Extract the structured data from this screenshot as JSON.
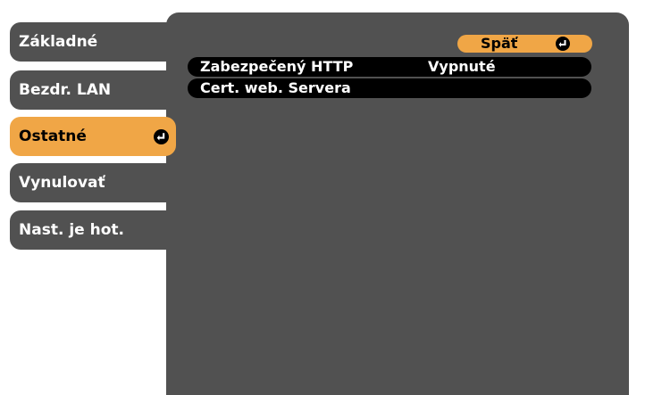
{
  "menu": {
    "tabs": [
      {
        "label": "Základné"
      },
      {
        "label": "Bezdr. LAN"
      },
      {
        "label": "Ostatné"
      },
      {
        "label": "Vynulovať"
      },
      {
        "label": "Nast. je hot."
      }
    ],
    "selected_index": 2
  },
  "submenu": {
    "back_label": "Späť",
    "items": [
      {
        "label": "Zabezpečený HTTP",
        "value": "Vypnuté"
      },
      {
        "label": "Cert. web. Servera",
        "value": ""
      }
    ]
  },
  "colors": {
    "panel": "#515151",
    "highlight": "#f0a646",
    "row": "#000000",
    "background": "#ffffff"
  },
  "icons": {
    "enter": "enter-icon"
  }
}
